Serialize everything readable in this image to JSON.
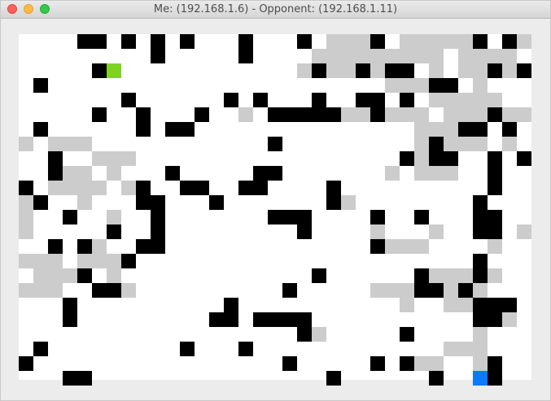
{
  "window": {
    "title": "Me: (192.168.1.6) - Opponent: (192.168.1.11)",
    "buttons": [
      "close",
      "minimize",
      "maximize"
    ]
  },
  "board": {
    "cols": 35,
    "rows": 24,
    "colors": {
      "background": "#ffffff",
      "wall": "#000000",
      "trail": "#cccccc",
      "me": "#7ed321",
      "opponent": "#0a7bff"
    },
    "me": {
      "col": 6,
      "row": 2
    },
    "opponent": {
      "col": 31,
      "row": 23
    },
    "grid": [
      "....##.#.#.#...#...#.ggg#.ggggg#.#g",
      ".........#.....#....ggggggggg.gggg.",
      ".....#.............g#gg#g##.g.gg#g#",
      ".#.......................ggg##.g..",
      ".......#......#.#...#..##.#.ggggg...",
      ".....#..#...#..g.#####gg#ggg.ggg#gg",
      ".#......#.##...............ggg##.#.",
      "g.ggg............#.........g#ggg.g.",
      "..#..ggg..................#g##..#.#",
      "..#gg.g...#.....##.......g.ggg..#..",
      "#.gggg.g#..##..##....#..........#",
      "g#..g...##...#.......#g........#..",
      "g..#..g..#.......###....#..#...##",
      "g.....#..#.........#....g...g..##.g#",
      "..#.#g..##..............#ggg....g",
      "ggg.ggg#.......................#",
      ".ggg#.g.............#......#ggg#g..g",
      "ggg..##g..........#.....ggg##g#g...",
      "...#..........#...........g..gg###",
      "...#.........##.####...........##g.",
      "...................#g.....#....g..",
      ".#.........#...#.............ggg...",
      "#.................#.....#.#gg..g#...",
      "...##................#......#..##.."
    ]
  }
}
